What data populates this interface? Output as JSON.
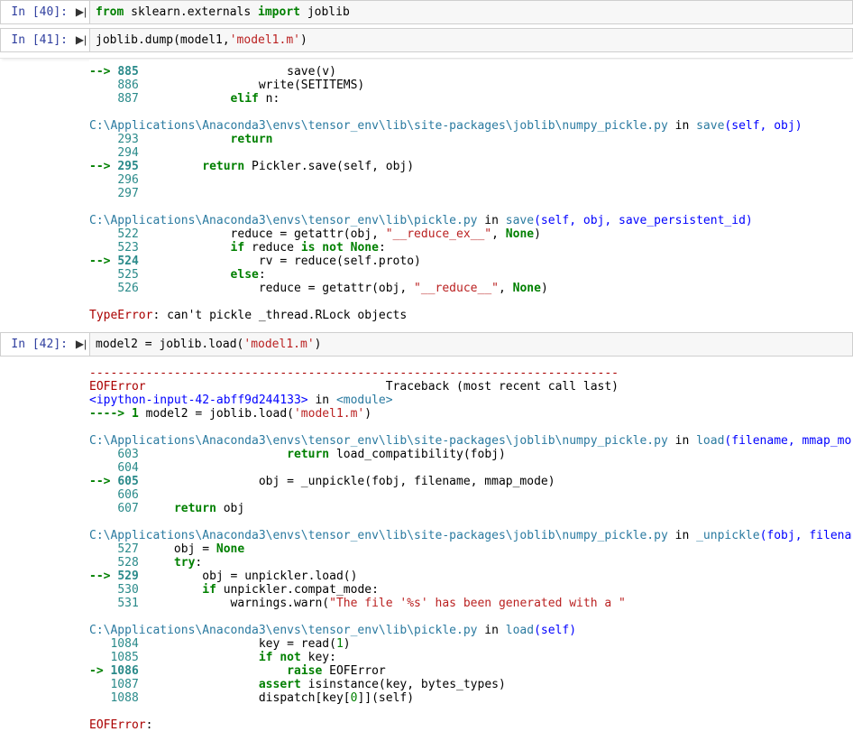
{
  "cells": [
    {
      "prompt": "In [40]:",
      "code_html": "<span class='kw'>from</span> sklearn.externals <span class='kw'>import</span> joblib"
    },
    {
      "prompt": "In [41]:",
      "code_html": "joblib.dump(model1,<span class='str'>'model1.m'</span>)",
      "output_lines": [
        "<span class='arrow'>--&gt; </span><span class='lnb'>885</span>                     save(v)",
        "    <span class='ln'>886</span>                 write(SETITEMS)",
        "    <span class='ln'>887</span>             <span class='kw2'>elif</span> n:",
        "",
        "<span class='path'>C:\\Applications\\Anaconda3\\envs\\tensor_env\\lib\\site-packages\\joblib\\numpy_pickle.py</span> in <span class='call'>save</span><span class='fn'>(self, obj)</span>",
        "    <span class='ln'>293</span>             <span class='kw2'>return</span>",
        "    <span class='ln'>294</span>",
        "<span class='arrow'>--&gt; </span><span class='lnb'>295</span>         <span class='kw2'>return</span> Pickler.save(self, obj)",
        "    <span class='ln'>296</span>",
        "    <span class='ln'>297</span>",
        "",
        "<span class='path'>C:\\Applications\\Anaconda3\\envs\\tensor_env\\lib\\pickle.py</span> in <span class='call'>save</span><span class='fn'>(self, obj, save_persistent_id)</span>",
        "    <span class='ln'>522</span>             reduce = getattr(obj, <span class='str'>\"__reduce_ex__\"</span>, <span class='kw2'>None</span>)",
        "    <span class='ln'>523</span>             <span class='kw2'>if</span> reduce <span class='kw2'>is not</span> <span class='kw2'>None</span>:",
        "<span class='arrow'>--&gt; </span><span class='lnb'>524</span>                 rv = reduce(self.proto)",
        "    <span class='ln'>525</span>             <span class='kw2'>else</span>:",
        "    <span class='ln'>526</span>                 reduce = getattr(obj, <span class='str'>\"__reduce__\"</span>, <span class='kw2'>None</span>)",
        "",
        "<span class='err-name'>TypeError</span>: can't pickle _thread.RLock objects"
      ],
      "shadow_before_output": true
    },
    {
      "prompt": "In [42]:",
      "code_html": "model2 = joblib.load(<span class='str'>'model1.m'</span>)",
      "output_lines": [
        "<span class='err-dash'>---------------------------------------------------------------------------</span>",
        "<span class='err-name'>EOFError</span>                                  Traceback (most recent call last)",
        "<span class='fn'>&lt;ipython-input-42-abff9d244133&gt;</span> in <span class='mod'>&lt;module&gt;</span>",
        "<span class='arrow'>----&gt; 1</span> model2 = joblib.load(<span class='str'>'model1.m'</span>)",
        "",
        "<span class='path'>C:\\Applications\\Anaconda3\\envs\\tensor_env\\lib\\site-packages\\joblib\\numpy_pickle.py</span> in <span class='call'>load</span><span class='fn'>(filename, mmap_mode)</span>",
        "    <span class='ln'>603</span>                     <span class='kw2'>return</span> load_compatibility(fobj)",
        "    <span class='ln'>604</span>",
        "<span class='arrow'>--&gt; </span><span class='lnb'>605</span>                 obj = _unpickle(fobj, filename, mmap_mode)",
        "    <span class='ln'>606</span>",
        "    <span class='ln'>607</span>     <span class='kw2'>return</span> obj",
        "",
        "<span class='path'>C:\\Applications\\Anaconda3\\envs\\tensor_env\\lib\\site-packages\\joblib\\numpy_pickle.py</span> in <span class='call'>_unpickle</span><span class='fn'>(fobj, filename, mmap_mode)</span>",
        "    <span class='ln'>527</span>     obj = <span class='kw2'>None</span>",
        "    <span class='ln'>528</span>     <span class='kw2'>try</span>:",
        "<span class='arrow'>--&gt; </span><span class='lnb'>529</span>         obj = unpickler.load()",
        "    <span class='ln'>530</span>         <span class='kw2'>if</span> unpickler.compat_mode:",
        "    <span class='ln'>531</span>             warnings.warn(<span class='str'>\"The file '%s' has been generated with a \"</span>",
        "",
        "<span class='path'>C:\\Applications\\Anaconda3\\envs\\tensor_env\\lib\\pickle.py</span> in <span class='call'>load</span><span class='fn'>(self)</span>",
        "   <span class='ln'>1084</span>                 key = read(<span class='num'>1</span>)",
        "   <span class='ln'>1085</span>                 <span class='kw2'>if</span> <span class='kw2'>not</span> key:",
        "<span class='arrow'>-&gt; </span><span class='lnb'>1086</span>                     <span class='kw2'>raise</span> EOFError",
        "   <span class='ln'>1087</span>                 <span class='kw2'>assert</span> isinstance(key, bytes_types)",
        "   <span class='ln'>1088</span>                 dispatch[key[<span class='num'>0</span>]](self)",
        "",
        "<span class='err-name'>EOFError</span>: "
      ]
    }
  ],
  "run_icon_glyph": "▶|"
}
